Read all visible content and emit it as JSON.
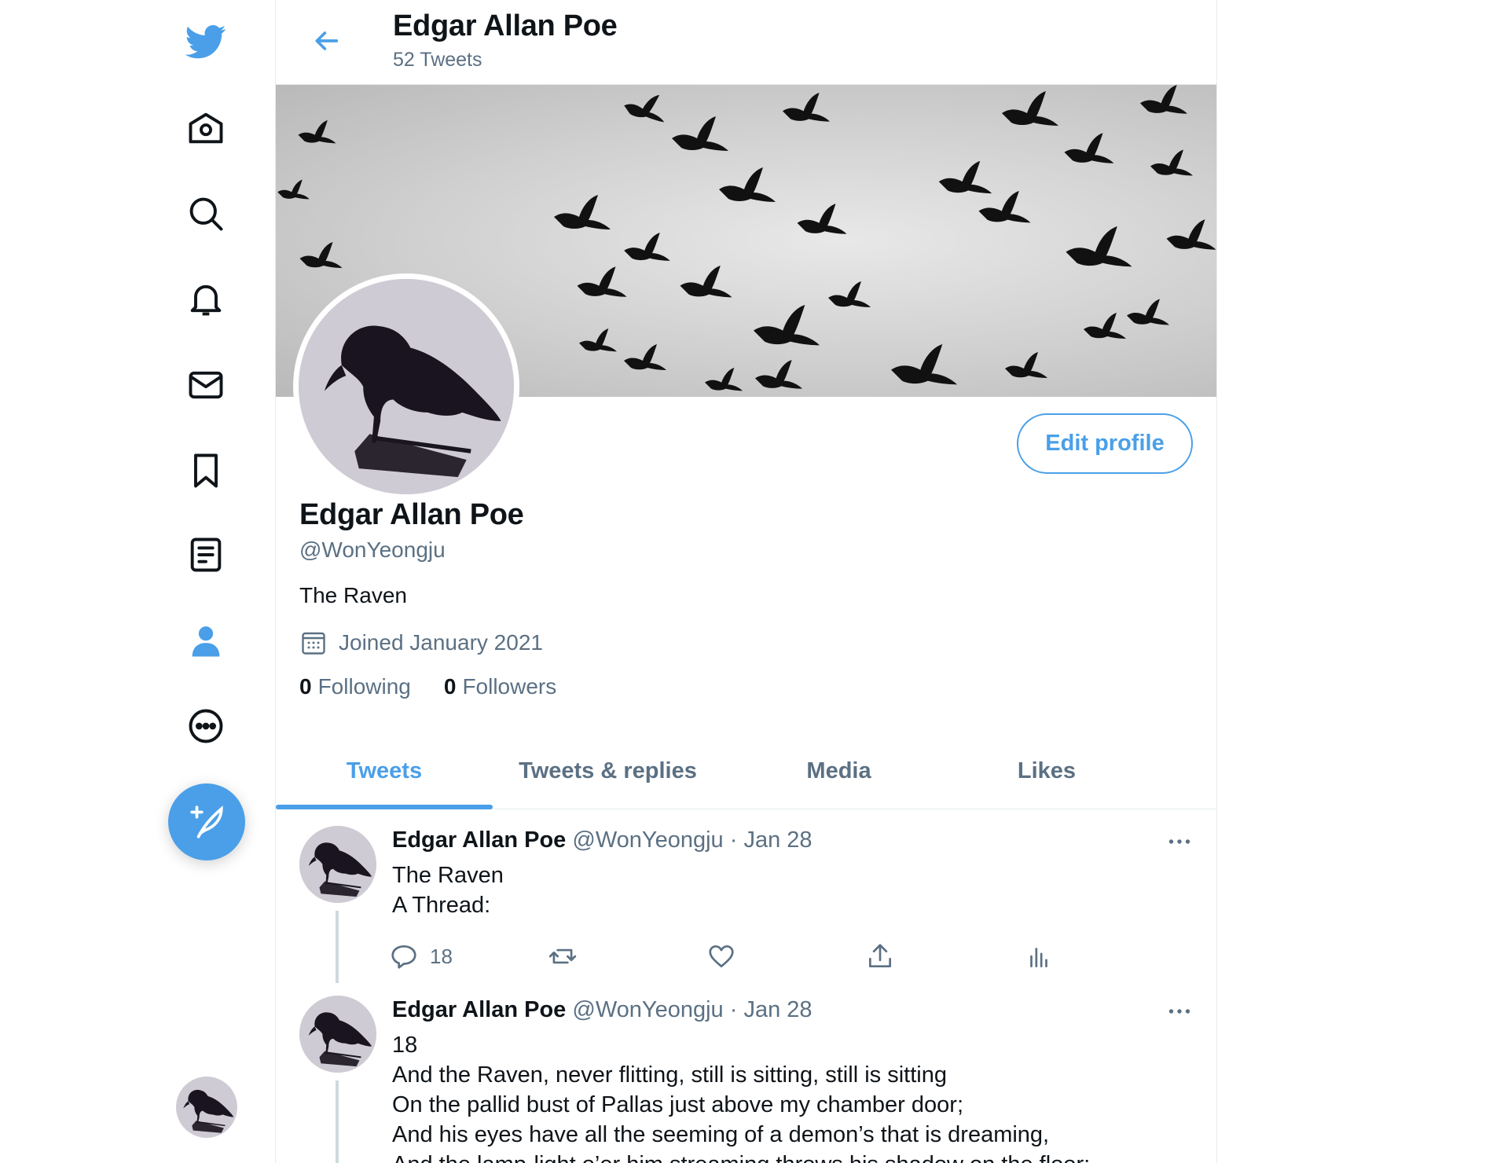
{
  "nav": {
    "items": [
      {
        "icon": "twitter-logo-icon"
      },
      {
        "icon": "home-icon"
      },
      {
        "icon": "explore-icon"
      },
      {
        "icon": "notifications-icon"
      },
      {
        "icon": "messages-icon"
      },
      {
        "icon": "bookmarks-icon"
      },
      {
        "icon": "lists-icon"
      },
      {
        "icon": "profile-icon",
        "active": true
      },
      {
        "icon": "more-icon"
      }
    ],
    "compose_icon": "compose-tweet-icon"
  },
  "header": {
    "title": "Edgar Allan Poe",
    "subtitle": "52 Tweets"
  },
  "profile": {
    "edit_button": "Edit profile",
    "name": "Edgar Allan Poe",
    "handle": "@WonYeongju",
    "bio": "The Raven",
    "joined": "Joined January 2021",
    "following_count": "0",
    "following_label": "Following",
    "followers_count": "0",
    "followers_label": "Followers"
  },
  "tabs": [
    {
      "label": "Tweets",
      "active": true
    },
    {
      "label": "Tweets & replies"
    },
    {
      "label": "Media"
    },
    {
      "label": "Likes"
    }
  ],
  "tweets": [
    {
      "name": "Edgar Allan Poe",
      "handle": "@WonYeongju",
      "dot": "·",
      "date": "Jan 28",
      "lines": [
        "The Raven",
        "A Thread:"
      ],
      "reply_count": "18"
    },
    {
      "name": "Edgar Allan Poe",
      "handle": "@WonYeongju",
      "dot": "·",
      "date": "Jan 28",
      "lines": [
        "18",
        "And the Raven, never flitting, still is sitting, still is sitting",
        "On the pallid bust of Pallas just above my chamber door;",
        "And his eyes have all the seeming of a demon’s that is dreaming,",
        "And the lamp-light o’er him streaming throws his shadow on the floor;"
      ]
    }
  ],
  "colors": {
    "accent": "#4a9fe8",
    "text": "#0f1419",
    "secondary": "#5b7083",
    "border": "#e6ecf0"
  }
}
